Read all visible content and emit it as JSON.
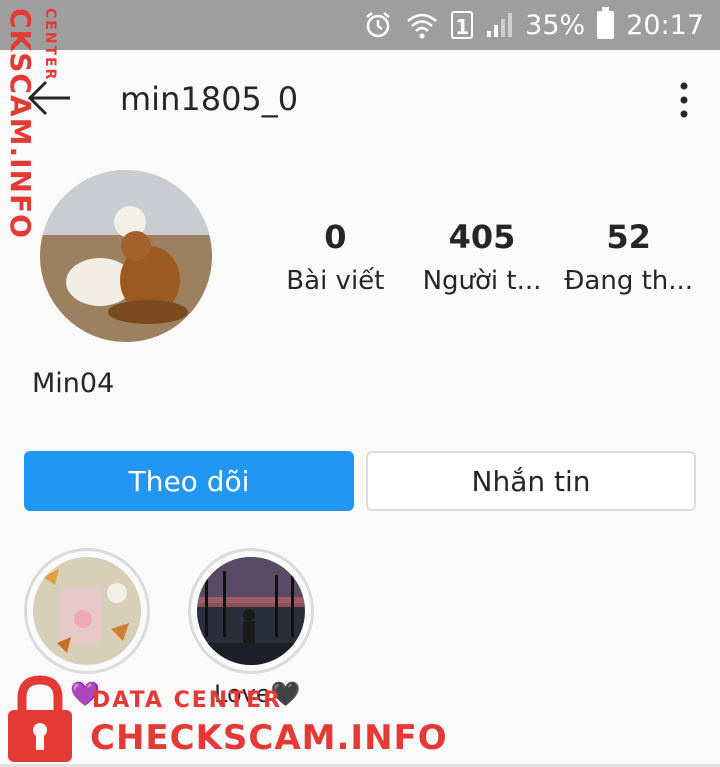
{
  "status_bar": {
    "battery": "35%",
    "time": "20:17",
    "sim_label": "1",
    "icons": [
      "alarm-icon",
      "wifi-icon",
      "sim-icon",
      "signal-icon",
      "battery-icon"
    ]
  },
  "header": {
    "username": "min1805_0",
    "back_icon": "back-arrow-icon",
    "menu_icon": "more-vertical-icon"
  },
  "profile": {
    "display_name": "Min04",
    "stats": [
      {
        "value": "0",
        "label": "Bài viết"
      },
      {
        "value": "405",
        "label": "Người t..."
      },
      {
        "value": "52",
        "label": "Đang th..."
      }
    ]
  },
  "actions": {
    "follow_label": "Theo dõi",
    "message_label": "Nhắn tin",
    "follow_color": "#2196f3"
  },
  "highlights": [
    {
      "label": "💜"
    },
    {
      "label": "Love🖤"
    }
  ],
  "watermark": {
    "vertical_big": "CKSCAM.INFO",
    "vertical_small": "CENTER",
    "small_text": "DATA CENTER",
    "big_text": "CHECKSCAM.INFO",
    "color": "#e53935"
  }
}
